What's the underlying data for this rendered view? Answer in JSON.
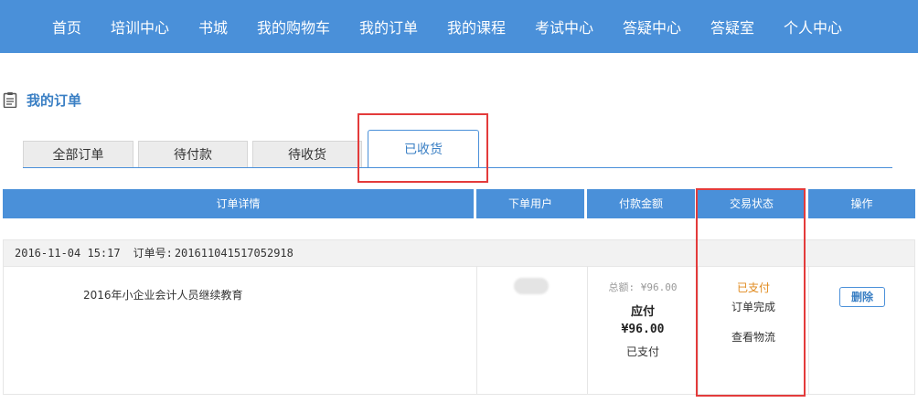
{
  "nav": {
    "items": [
      "首页",
      "培训中心",
      "书城",
      "我的购物车",
      "我的订单",
      "我的课程",
      "考试中心",
      "答疑中心",
      "答疑室",
      "个人中心"
    ]
  },
  "page": {
    "title": "我的订单"
  },
  "tabs": {
    "items": [
      "全部订单",
      "待付款",
      "待收货",
      "已收货"
    ],
    "active": "已收货"
  },
  "table": {
    "headers": [
      "订单详情",
      "下单用户",
      "付款金额",
      "交易状态",
      "操作"
    ]
  },
  "order": {
    "datetime": "2016-11-04 15:17",
    "order_no_label": "订单号:",
    "order_no": "201611041517052918",
    "product": "2016年小企业会计人员继续教育",
    "total": "总额: ¥96.00",
    "due_label": "应付",
    "due_amount": "¥96.00",
    "pay_status": "已支付",
    "status_paid": "已支付",
    "status_done": "订单完成",
    "logistics": "查看物流",
    "delete_label": "删除"
  },
  "colors": {
    "primary": "#4a90d9",
    "highlight_box": "#e33b3b",
    "paid": "#e08a1e"
  }
}
